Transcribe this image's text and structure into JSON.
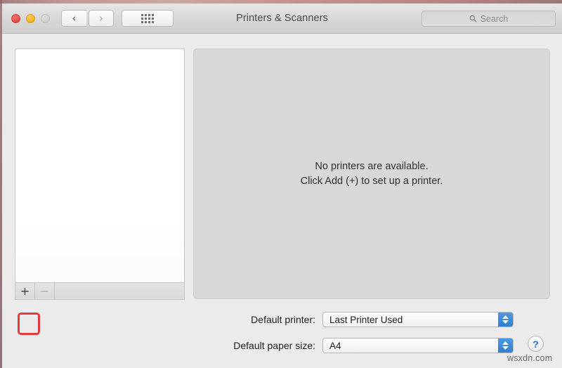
{
  "window": {
    "title": "Printers & Scanners",
    "traffic_lights": [
      {
        "name": "close",
        "color": "#e8483f"
      },
      {
        "name": "minimize",
        "color": "#f2b01f"
      },
      {
        "name": "zoom",
        "color": "#cdcdcc"
      }
    ],
    "nav": {
      "back_label": "‹",
      "forward_label": "›"
    },
    "show_all_label": "show-all-grid"
  },
  "search": {
    "placeholder": "Search",
    "icon": "search-icon"
  },
  "printer_list": {
    "items": [],
    "toolbar": {
      "add_label": "+",
      "remove_label": "−",
      "add_highlighted": true,
      "remove_enabled": false,
      "highlight_color": "#e23b3b"
    }
  },
  "main_panel": {
    "empty_line1": "No printers are available.",
    "empty_line2": "Click Add (+) to set up a printer."
  },
  "settings": {
    "default_printer": {
      "label": "Default printer:",
      "value": "Last Printer Used"
    },
    "default_paper_size": {
      "label": "Default paper size:",
      "value": "A4"
    },
    "stepper_color": "#2f7ed0"
  },
  "help": {
    "label": "?"
  },
  "watermark": {
    "text": "wsxdn.com"
  }
}
